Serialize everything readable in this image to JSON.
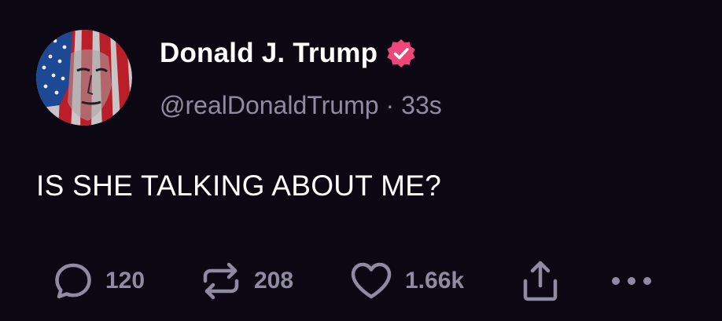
{
  "post": {
    "author": {
      "display_name": "Donald J. Trump",
      "handle": "@realDonaldTrump",
      "verified": true,
      "verified_badge_color": "#f0457a",
      "avatar_icon": "flag-portrait-avatar"
    },
    "separator": "·",
    "timestamp": "33s",
    "text": "IS SHE TALKING ABOUT ME?",
    "actions": {
      "reply": {
        "icon": "reply-icon",
        "count": "120"
      },
      "repost": {
        "icon": "repost-icon",
        "count": "208"
      },
      "like": {
        "icon": "heart-icon",
        "count": "1.66k"
      },
      "share": {
        "icon": "share-icon"
      },
      "more": {
        "icon": "more-icon"
      }
    }
  },
  "colors": {
    "background": "#0b0814",
    "text_primary": "#ffffff",
    "text_secondary": "#8f8ba0",
    "verified": "#f0457a"
  }
}
